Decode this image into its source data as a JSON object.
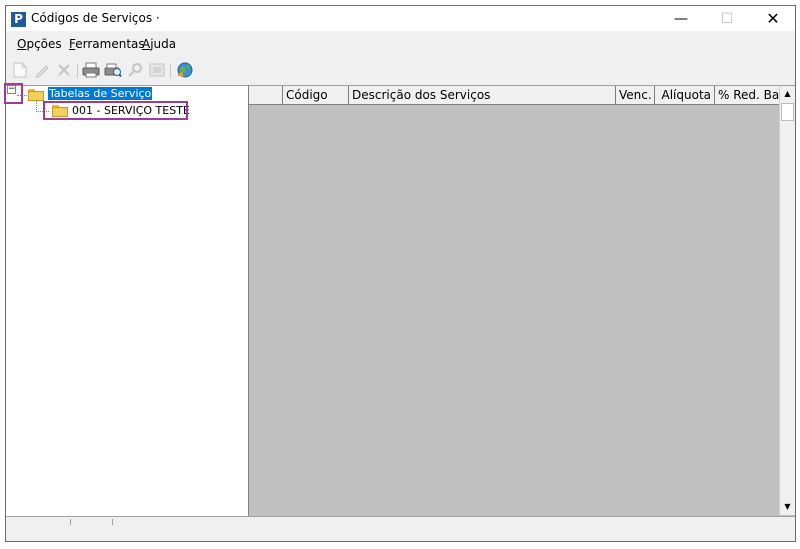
{
  "window": {
    "title": "Códigos de Serviços ·",
    "app_icon_letter": "P",
    "minimize_glyph": "—",
    "maximize_glyph": "☐",
    "close_glyph": "✕"
  },
  "menu": [
    {
      "underlined": "O",
      "rest": "pções"
    },
    {
      "underlined": "F",
      "rest": "erramentas"
    },
    {
      "underlined": "A",
      "rest": "juda"
    }
  ],
  "toolbar": [
    {
      "icon": "new-document-icon",
      "enabled": false
    },
    {
      "icon": "edit-pencil-icon",
      "enabled": false
    },
    {
      "icon": "delete-x-icon",
      "enabled": false
    },
    {
      "icon": "print-icon",
      "enabled": true
    },
    {
      "icon": "print-preview-icon",
      "enabled": true
    },
    {
      "icon": "search-icon",
      "enabled": false
    },
    {
      "icon": "report-icon",
      "enabled": false
    },
    {
      "icon": "refresh-globe-icon",
      "enabled": true
    }
  ],
  "tree": {
    "root_label": "Tabelas de Serviço",
    "root_expanded": true,
    "expander_glyph": "−",
    "children": [
      {
        "label": "001 - SERVIÇO TESTE"
      }
    ]
  },
  "grid": {
    "columns": [
      "",
      "Código",
      "Descrição dos Serviços",
      "Venc.",
      "Alíquota",
      "% Red. Bas"
    ],
    "rows": []
  },
  "colors": {
    "selection": "#0078d7",
    "highlight_box": "#9b3c9b",
    "grid_background": "#c0c0c0"
  }
}
